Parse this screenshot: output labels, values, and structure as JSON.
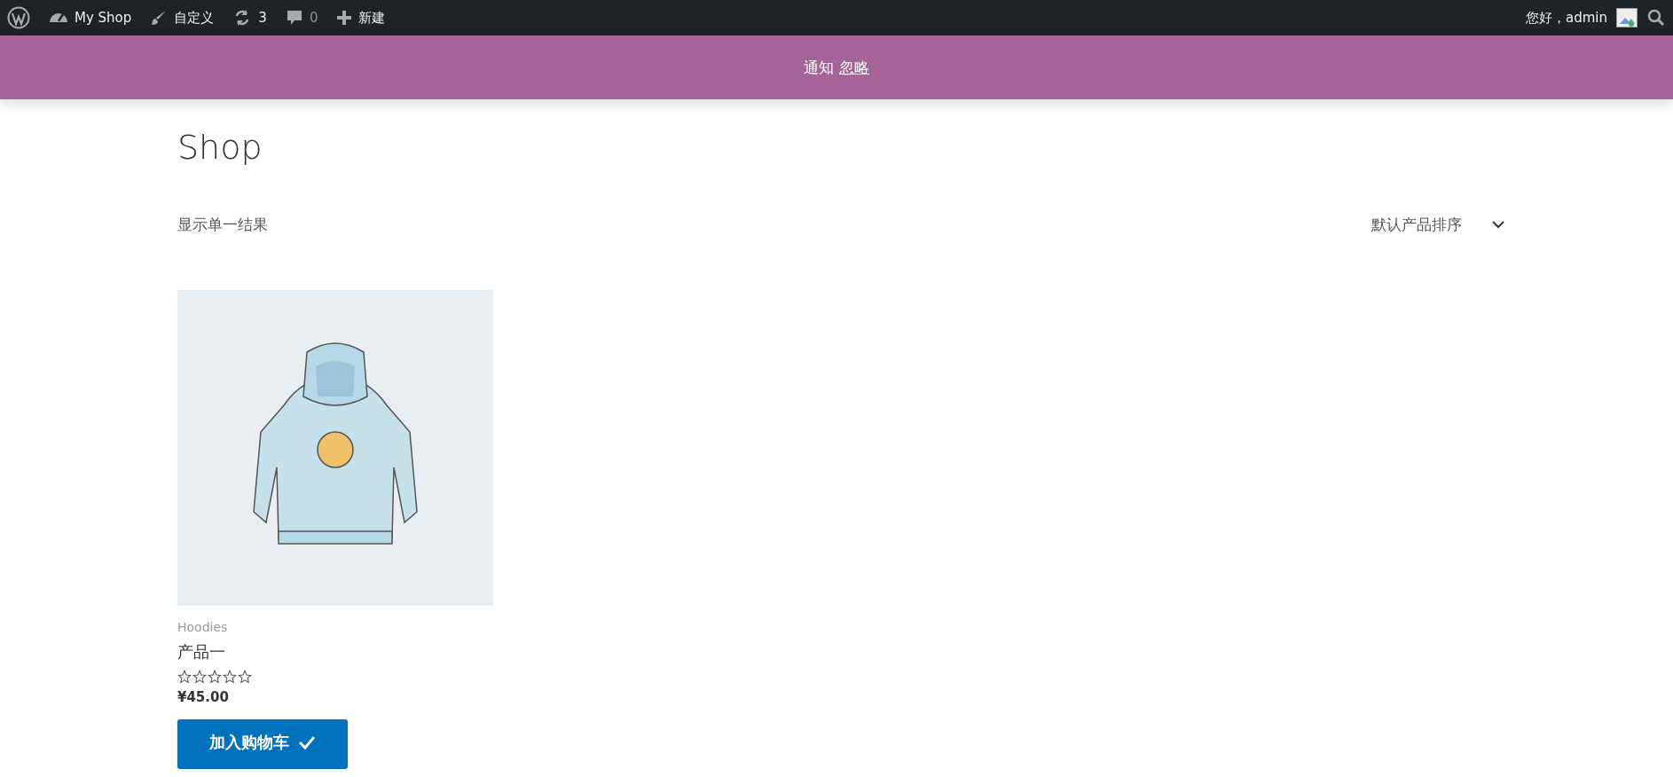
{
  "admin_bar": {
    "site": "My Shop",
    "customize": "自定义",
    "updates": "3",
    "comments": "0",
    "new": "新建",
    "greeting": "您好，admin"
  },
  "notice": {
    "text": "通知",
    "dismiss": "忽略"
  },
  "page": {
    "title": "Shop",
    "result_count": "显示单一结果",
    "sort": "默认产品排序"
  },
  "products": [
    {
      "category": "Hoodies",
      "name": "产品一",
      "stars": 0,
      "price": "¥45.00",
      "button": "加入购物车",
      "added": true
    }
  ]
}
